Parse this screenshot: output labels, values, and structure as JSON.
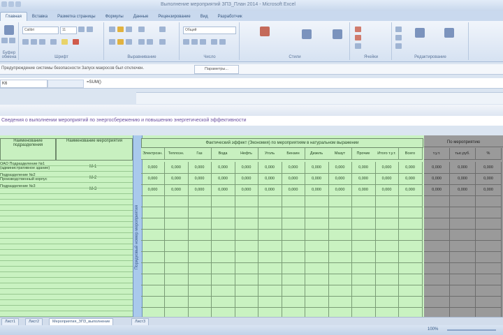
{
  "window": {
    "title": "Выполнение мероприятий ЗПЗ_План 2014 - Microsoft Excel"
  },
  "tabs": [
    "Главная",
    "Вставка",
    "Разметка страницы",
    "Формулы",
    "Данные",
    "Рецензирование",
    "Вид",
    "Разработчик"
  ],
  "ribbon": {
    "groups": [
      "Буфер обмена",
      "Шрифт",
      "Выравнивание",
      "Число",
      "Стили",
      "Ячейки",
      "Редактирование"
    ],
    "font_name": "Calibri",
    "font_size": "11",
    "number_format": "Общий"
  },
  "message_bar": {
    "text": "Предупреждение системы безопасности   Запуск макросов был отключен.",
    "button": "Параметры..."
  },
  "formula_bar": {
    "name_box": "K6",
    "formula": "=SUM()"
  },
  "sheet_title": "Сведения о выполнении мероприятий по энергосбережению и повышению энергетической эффективности",
  "table": {
    "left_headers": [
      "Наименование подразделения",
      "Наименование мероприятия"
    ],
    "group_header": "Фактический эффект (Экономия) по мероприятиям в натуральном выражении",
    "right_group_header": "По мероприятию",
    "vertical_label": "Порядковый номер мероприятия",
    "sub_headers": [
      "Электроэн.",
      "Теплоэн.",
      "Газ",
      "Вода",
      "Нефть",
      "Уголь",
      "Бензин",
      "Дизель",
      "Мазут",
      "Прочие",
      "Итого т.у.т.",
      "Всего"
    ],
    "dark_headers": [
      "т.у.т.",
      "тыс.руб.",
      "%"
    ],
    "rows": [
      {
        "name": "ОАО Подразделение №1 (административное здание)",
        "measure": "М-1",
        "values": [
          "0,000",
          "0,000",
          "0,000",
          "0,000",
          "0,000",
          "0,000",
          "0,000",
          "0,000",
          "0,000",
          "0,000",
          "0,000",
          "0,000"
        ],
        "dark": [
          "0,000",
          "0,000",
          "0,000"
        ]
      },
      {
        "name": "Подразделение №2 Производственный корпус",
        "measure": "М-2",
        "values": [
          "0,000",
          "0,000",
          "0,000",
          "0,000",
          "0,000",
          "0,000",
          "0,000",
          "0,000",
          "0,000",
          "0,000",
          "0,000",
          "0,000"
        ],
        "dark": [
          "0,000",
          "0,000",
          "0,000"
        ]
      },
      {
        "name": "Подразделение №3",
        "measure": "М-3",
        "values": [
          "0,000",
          "0,000",
          "0,000",
          "0,000",
          "0,000",
          "0,000",
          "0,000",
          "0,000",
          "0,000",
          "0,000",
          "0,000",
          "0,000"
        ],
        "dark": [
          "0,000",
          "0,000",
          "0,000"
        ]
      }
    ]
  },
  "sheet_tabs": [
    "Лист1",
    "Лист2",
    "Мероприятия_ЗПЗ_выполнение",
    "Лист3"
  ],
  "status": {
    "zoom": "100%"
  },
  "colors": {
    "green": "#c9f2c1",
    "blue_bar": "#a9c9ec",
    "dark": "#9a9a9a"
  }
}
